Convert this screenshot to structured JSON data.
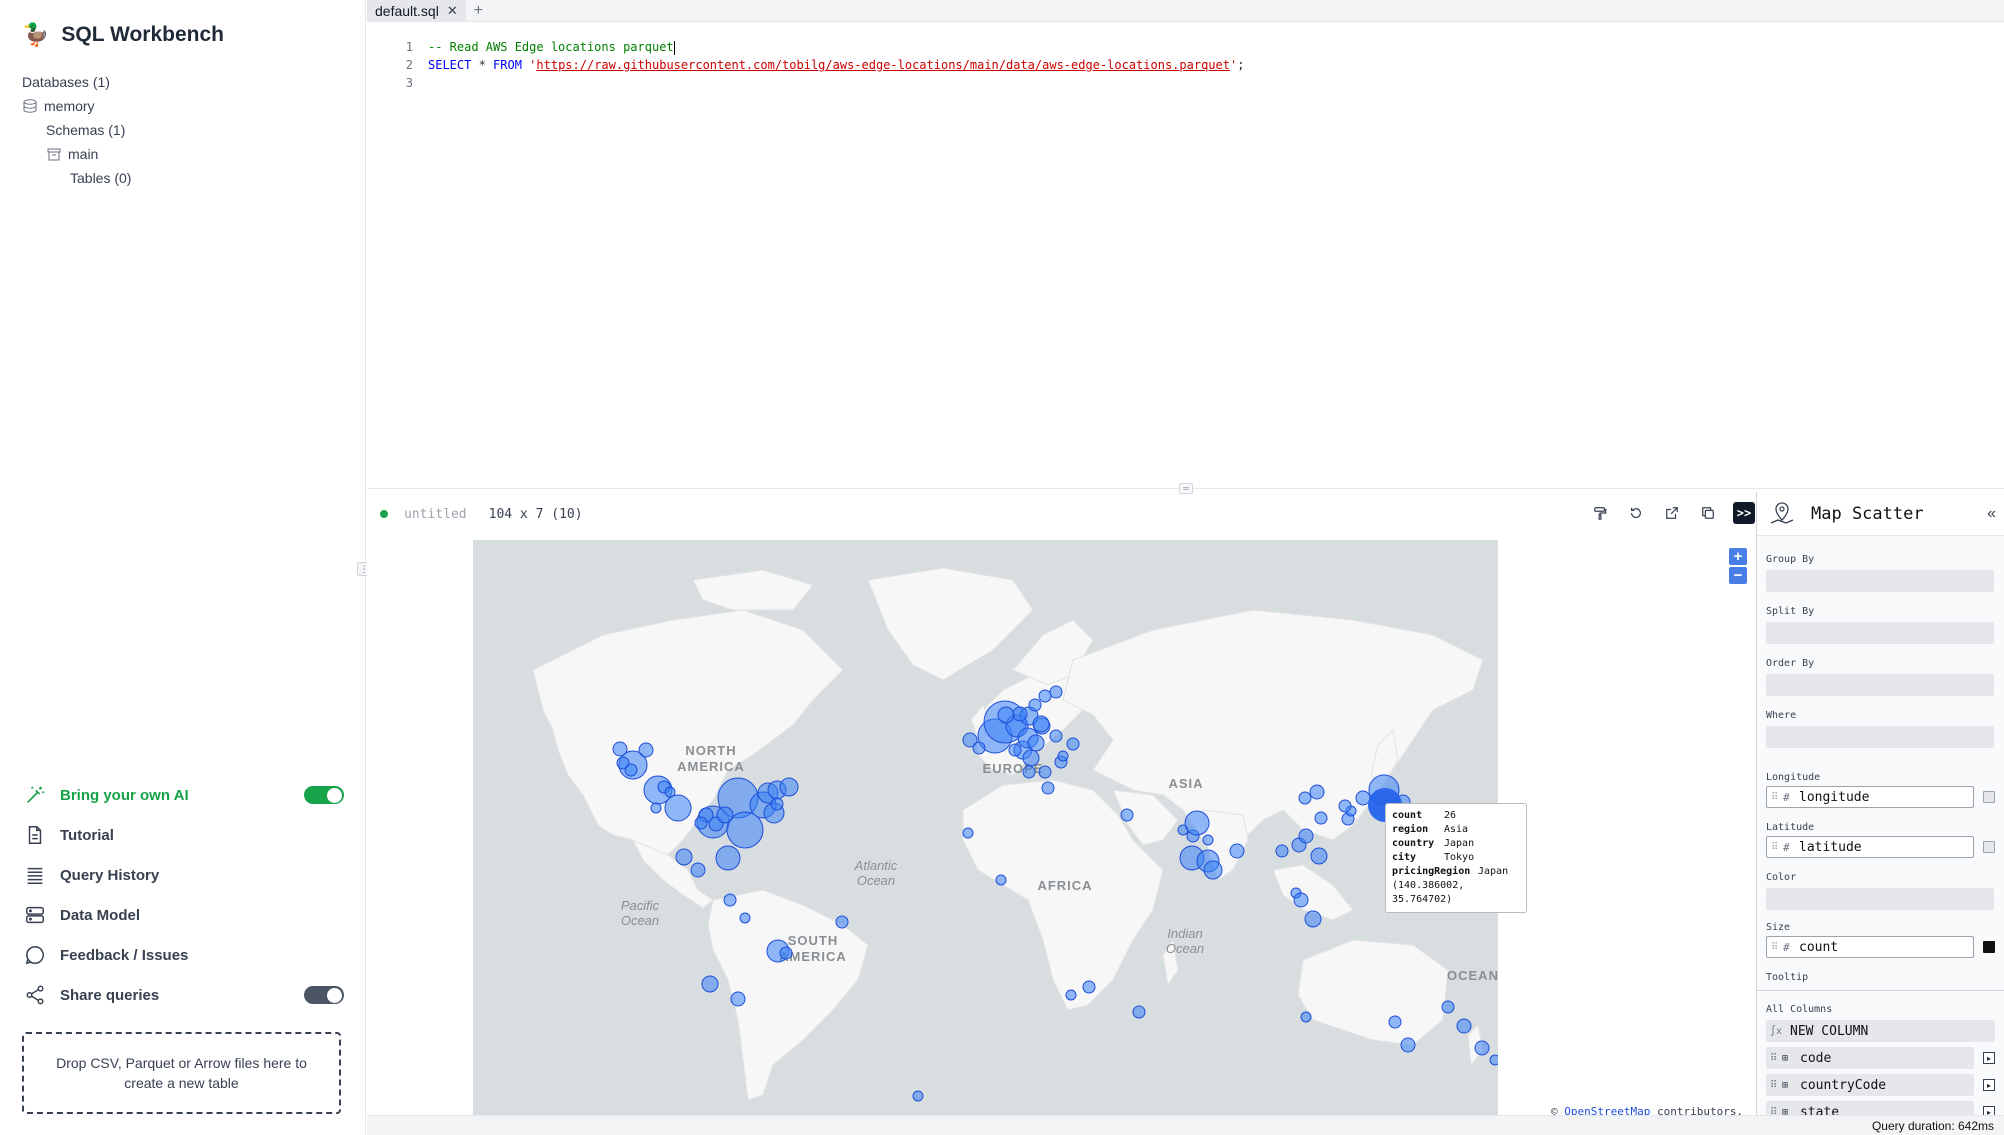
{
  "app": {
    "title": "SQL Workbench"
  },
  "tree": {
    "databases": "Databases (1)",
    "db": "memory",
    "schemas": "Schemas (1)",
    "schema": "main",
    "tables": "Tables (0)"
  },
  "menu": {
    "ai": "Bring your own AI",
    "tutorial": "Tutorial",
    "history": "Query History",
    "model": "Data Model",
    "feedback": "Feedback / Issues",
    "share": "Share queries"
  },
  "dropzone": "Drop CSV, Parquet or Arrow files here to create a new table",
  "editor": {
    "tab": "default.sql",
    "line1": "-- Read AWS Edge locations parquet",
    "line2_kw1": "SELECT",
    "line2_star": " * ",
    "line2_kw2": "FROM",
    "line2_q1": " '",
    "line2_url": "https://raw.githubusercontent.com/tobilg/aws-edge-locations/main/data/aws-edge-locations.parquet",
    "line2_q2": "'",
    "line2_end": ";",
    "line_numbers": [
      "1",
      "2",
      "3"
    ]
  },
  "result": {
    "name": "untitled",
    "size": "104 x 7 (10)"
  },
  "map": {
    "labels": {
      "na": "NORTH\nAMERICA",
      "sa": "SOUTH\nAMERICA",
      "eu": "EUROPE",
      "af": "AFRICA",
      "asia": "ASIA",
      "atl": "Atlantic\nOcean",
      "pac": "Pacific\nOcean",
      "ind": "Indian\nOcean",
      "oce": "OCEAN"
    },
    "tooltip": {
      "count_k": "count",
      "count_v": "26",
      "region_k": "region",
      "region_v": "Asia",
      "country_k": "country",
      "country_v": "Japan",
      "city_k": "city",
      "city_v": "Tokyo",
      "pr_k": "pricingRegion",
      "pr_v": "Japan",
      "coords": "(140.386002, 35.764702)"
    },
    "attribution_pre": "© ",
    "attribution_link": "OpenStreetMap",
    "attribution_post": " contributors.",
    "zoom_in": "+",
    "zoom_out": "−"
  },
  "panel": {
    "title": "Map Scatter",
    "group_by": "Group By",
    "split_by": "Split By",
    "order_by": "Order By",
    "where": "Where",
    "longitude_lbl": "Longitude",
    "longitude_val": "longitude",
    "latitude_lbl": "Latitude",
    "latitude_val": "latitude",
    "color_lbl": "Color",
    "size_lbl": "Size",
    "size_val": "count",
    "tooltip_lbl": "Tooltip",
    "all_columns": "All Columns",
    "new_column": "NEW COLUMN",
    "columns": [
      "code",
      "countryCode",
      "state"
    ],
    "hash": "#"
  },
  "status": {
    "query_duration": "Query duration: 642ms"
  },
  "colors": {
    "accent": "#16a34a",
    "point": "#3b82f6",
    "map_water": "#d8dde0",
    "map_land": "#f7f7f7"
  }
}
